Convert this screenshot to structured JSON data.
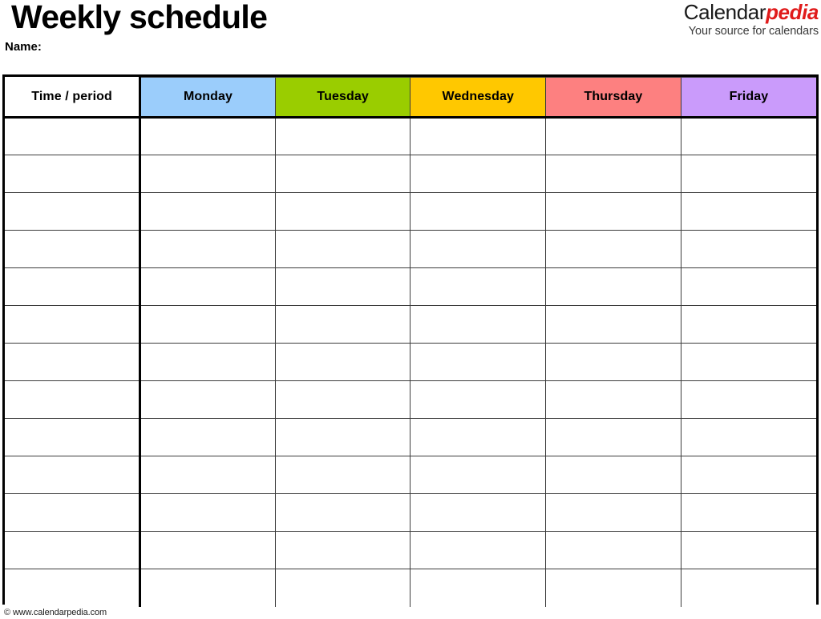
{
  "document": {
    "title": "Weekly schedule",
    "name_label": "Name:"
  },
  "logo": {
    "word_first": "Calendar",
    "word_second": "pedia",
    "tagline": "Your source for calendars",
    "color_first": "#1a1a1a",
    "color_second": "#e01b1b"
  },
  "table": {
    "columns": [
      {
        "label": "Time / period",
        "color": "#ffffff",
        "key": "time"
      },
      {
        "label": "Monday",
        "color": "#9BCDFB",
        "key": "monday"
      },
      {
        "label": "Tuesday",
        "color": "#9ACD00",
        "key": "tuesday"
      },
      {
        "label": "Wednesday",
        "color": "#FFC800",
        "key": "wednesday"
      },
      {
        "label": "Thursday",
        "color": "#FD8080",
        "key": "thursday"
      },
      {
        "label": "Friday",
        "color": "#CA9BFB",
        "key": "friday"
      }
    ],
    "row_count": 13,
    "rows": [
      {
        "time": "",
        "monday": "",
        "tuesday": "",
        "wednesday": "",
        "thursday": "",
        "friday": ""
      },
      {
        "time": "",
        "monday": "",
        "tuesday": "",
        "wednesday": "",
        "thursday": "",
        "friday": ""
      },
      {
        "time": "",
        "monday": "",
        "tuesday": "",
        "wednesday": "",
        "thursday": "",
        "friday": ""
      },
      {
        "time": "",
        "monday": "",
        "tuesday": "",
        "wednesday": "",
        "thursday": "",
        "friday": ""
      },
      {
        "time": "",
        "monday": "",
        "tuesday": "",
        "wednesday": "",
        "thursday": "",
        "friday": ""
      },
      {
        "time": "",
        "monday": "",
        "tuesday": "",
        "wednesday": "",
        "thursday": "",
        "friday": ""
      },
      {
        "time": "",
        "monday": "",
        "tuesday": "",
        "wednesday": "",
        "thursday": "",
        "friday": ""
      },
      {
        "time": "",
        "monday": "",
        "tuesday": "",
        "wednesday": "",
        "thursday": "",
        "friday": ""
      },
      {
        "time": "",
        "monday": "",
        "tuesday": "",
        "wednesday": "",
        "thursday": "",
        "friday": ""
      },
      {
        "time": "",
        "monday": "",
        "tuesday": "",
        "wednesday": "",
        "thursday": "",
        "friday": ""
      },
      {
        "time": "",
        "monday": "",
        "tuesday": "",
        "wednesday": "",
        "thursday": "",
        "friday": ""
      },
      {
        "time": "",
        "monday": "",
        "tuesday": "",
        "wednesday": "",
        "thursday": "",
        "friday": ""
      },
      {
        "time": "",
        "monday": "",
        "tuesday": "",
        "wednesday": "",
        "thursday": "",
        "friday": ""
      }
    ]
  },
  "footer": {
    "copyright": "© www.calendarpedia.com"
  }
}
